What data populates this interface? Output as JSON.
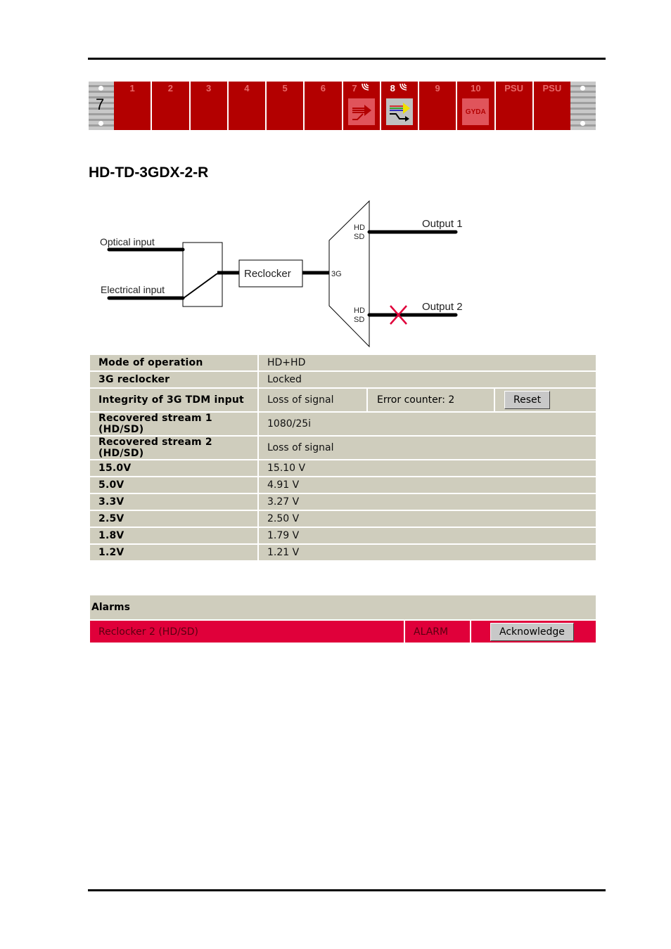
{
  "frame": {
    "number": "7",
    "slots": [
      {
        "label": "1",
        "active": false,
        "icon": null
      },
      {
        "label": "2",
        "active": false,
        "icon": null
      },
      {
        "label": "3",
        "active": false,
        "icon": null
      },
      {
        "label": "4",
        "active": false,
        "icon": null
      },
      {
        "label": "5",
        "active": false,
        "icon": null
      },
      {
        "label": "6",
        "active": false,
        "icon": null
      },
      {
        "label": "7",
        "active": false,
        "icon": "arrow-merge-icon",
        "wireless": true
      },
      {
        "label": "8",
        "active": true,
        "icon": "demux-colored-icon",
        "wireless": true
      },
      {
        "label": "9",
        "active": false,
        "icon": null
      },
      {
        "label": "10",
        "active": false,
        "icon": "gyda-logo-icon",
        "icon_text": "GYDA"
      },
      {
        "label": "PSU",
        "active": false,
        "icon": null
      },
      {
        "label": "PSU",
        "active": false,
        "icon": null
      }
    ],
    "wireless_glyph": "((("
  },
  "module_title": "HD-TD-3GDX-2-R",
  "diagram": {
    "optical_input": "Optical input",
    "electrical_input": "Electrical input",
    "reclocker": "Reclocker",
    "mux_input": "3G",
    "port1_hd": "HD",
    "port1_sd": "SD",
    "port2_hd": "HD",
    "port2_sd": "SD",
    "output1": "Output 1",
    "output2": "Output 2",
    "output2_failed": true,
    "fail_color": "#e0003a"
  },
  "status": {
    "mode_label": "Mode of operation",
    "mode_value": "HD+HD",
    "reclocker_label": "3G reclocker",
    "reclocker_value": "Locked",
    "integrity_label": "Integrity of 3G TDM input",
    "integrity_value": "Loss of signal",
    "error_counter": "Error counter: 2",
    "reset_label": "Reset",
    "stream1_label": "Recovered stream 1 (HD/SD)",
    "stream1_value": "1080/25i",
    "stream2_label": "Recovered stream 2 (HD/SD)",
    "stream2_value": "Loss of signal",
    "voltages": [
      {
        "label": "15.0V",
        "value": "15.10 V"
      },
      {
        "label": "5.0V",
        "value": "4.91 V"
      },
      {
        "label": "3.3V",
        "value": "3.27 V"
      },
      {
        "label": "2.5V",
        "value": "2.50 V"
      },
      {
        "label": "1.8V",
        "value": "1.79 V"
      },
      {
        "label": "1.2V",
        "value": "1.21 V"
      }
    ]
  },
  "alarms": {
    "header": "Alarms",
    "items": [
      {
        "name": "Reclocker 2 (HD/SD)",
        "state": "ALARM",
        "action": "Acknowledge"
      }
    ],
    "alarm_color": "#e0003a"
  },
  "colors": {
    "slot_red": "#b30000",
    "table_bg": "#cfcdbd"
  }
}
